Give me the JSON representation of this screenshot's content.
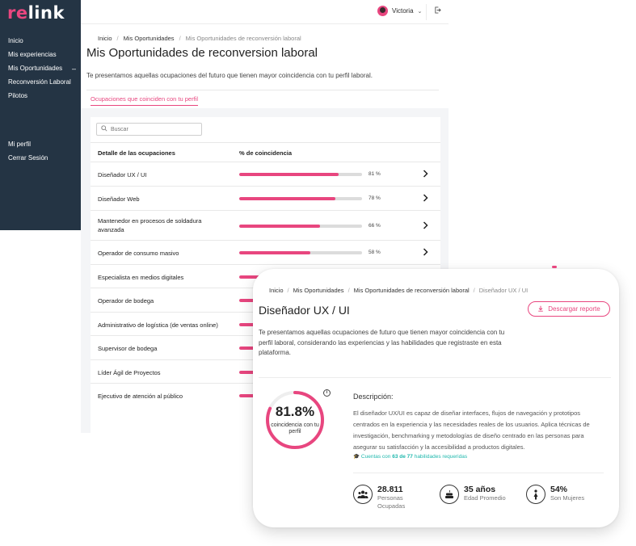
{
  "logo": {
    "part1": "re",
    "part2": "link"
  },
  "sidebar": {
    "items": [
      {
        "label": "Inicio"
      },
      {
        "label": "Mis experiencias"
      },
      {
        "label": "Mis Oportunidades",
        "suffix": "–"
      },
      {
        "label": "Reconversión Laboral"
      },
      {
        "label": "Pilotos"
      }
    ],
    "bottom": [
      {
        "label": "Mi perfil"
      },
      {
        "label": "Cerrar Sesión"
      }
    ]
  },
  "topbar": {
    "user_name": "Victoria",
    "chevron": "⌄",
    "logout_icon": "logout-icon"
  },
  "main": {
    "breadcrumb": [
      "Inicio",
      "Mis Oportunidades",
      "Mis Oportunidades de reconversión laboral"
    ],
    "title": "Mis Oportunidades de reconversion laboral",
    "description": "Te presentamos aquellas ocupaciones del futuro que tienen mayor coincidencia con tu perfil laboral.",
    "tab": "Ocupaciones que coinciden con tu perfil",
    "search_placeholder": "Buscar",
    "columns": [
      "Detalle de las ocupaciones",
      "% de coincidencia"
    ],
    "rows": [
      {
        "name": "Diseñador UX / UI",
        "pct": 81,
        "pct_label": "81 %"
      },
      {
        "name": "Diseñador Web",
        "pct": 78,
        "pct_label": "78 %"
      },
      {
        "name": "Mantenedor en procesos de soldadura avanzada",
        "pct": 66,
        "pct_label": "66 %"
      },
      {
        "name": "Operador de consumo masivo",
        "pct": 58,
        "pct_label": "58 %"
      },
      {
        "name": "Especialista en medios digitales",
        "pct": 0.55
      },
      {
        "name": "Operador de bodega",
        "pct": 0.5
      },
      {
        "name": "Administrativo de logística (de ventas online)",
        "pct": 0.45
      },
      {
        "name": "Supervisor de bodega",
        "pct": 0.4
      },
      {
        "name": "Líder Ágil de Proyectos",
        "pct": 0.35
      },
      {
        "name": "Ejecutivo de atención al público",
        "pct": 0.3
      }
    ]
  },
  "detail": {
    "breadcrumb": [
      "Inicio",
      "Mis Oportunidades",
      "Mis Oportunidades de reconversión laboral",
      "Diseñador UX / UI"
    ],
    "title": "Diseñador UX / UI",
    "download_label": "Descargar reporte",
    "description": "Te presentamos aquellas ocupaciones de futuro que tienen mayor coincidencia con tu perfil laboral, considerando las experiencias y las habilidades que registraste en esta plataforma.",
    "match_value": "81.8%",
    "match_fraction": 0.818,
    "match_label": "coincidencia con tu perfil",
    "info": "i",
    "desc_heading": "Descripción:",
    "desc_body": "El diseñador UX/UI es capaz de diseñar interfaces, flujos de navegación y prototipos centrados en la experiencia y las necesidades reales de los usuarios. Aplica técnicas de investigación, benchmarking y metodologías de diseño centrado en las personas para asegurar su satisfacción y la accesibilidad a productos digitales.",
    "skills_pre": "Cuentas con",
    "skills_count": "63 de 77",
    "skills_post": "habilidades requeridas",
    "stats": [
      {
        "value": "28.811",
        "label": "Personas Ocupadas",
        "icon": "people-icon"
      },
      {
        "value": "35 años",
        "label": "Edad Promedio",
        "icon": "cake-icon"
      },
      {
        "value": "54%",
        "label": "Son Mujeres",
        "icon": "woman-icon"
      }
    ]
  },
  "colors": {
    "accent": "#e8467f",
    "sidebar": "#243444",
    "teal": "#1fb8ad"
  }
}
